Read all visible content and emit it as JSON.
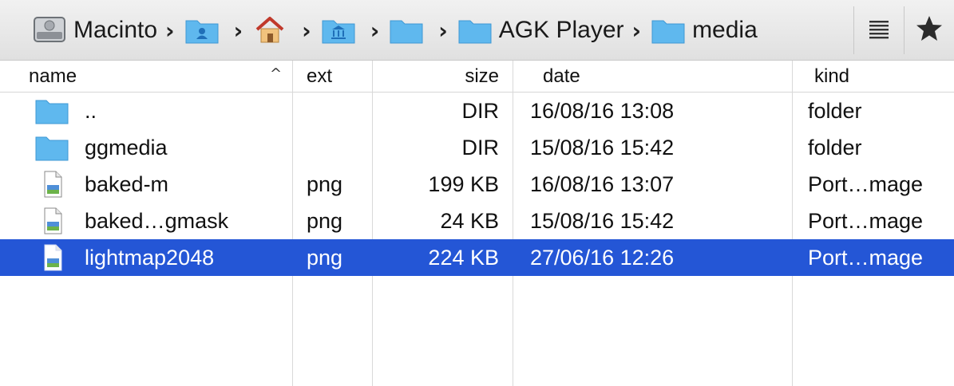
{
  "pathbar": {
    "crumbs": [
      {
        "label": "Macinto",
        "icon": "hard-drive-icon"
      },
      {
        "label": "",
        "icon": "user-home-folder-icon"
      },
      {
        "label": "",
        "icon": "house-icon"
      },
      {
        "label": "",
        "icon": "applications-folder-icon"
      },
      {
        "label": "",
        "icon": "folder-icon"
      },
      {
        "label": "AGK Player",
        "icon": "folder-icon"
      },
      {
        "label": "media",
        "icon": "folder-icon"
      }
    ],
    "separator": "›",
    "view_icon": "list-view-icon",
    "favorite_icon": "star-icon"
  },
  "header": {
    "name": "name",
    "ext": "ext",
    "size": "size",
    "date": "date",
    "kind": "kind",
    "sort_indicator": "^"
  },
  "files": [
    {
      "name": "..",
      "ext": "",
      "size": "DIR",
      "date": "16/08/16 13:08",
      "kind": "folder",
      "icon": "folder-icon",
      "selected": false
    },
    {
      "name": "ggmedia",
      "ext": "",
      "size": "DIR",
      "date": "15/08/16 15:42",
      "kind": "folder",
      "icon": "folder-icon",
      "selected": false
    },
    {
      "name": "baked-m",
      "ext": "png",
      "size": "199 KB",
      "date": "16/08/16 13:07",
      "kind": "Port…mage",
      "icon": "png-file-icon",
      "selected": false
    },
    {
      "name": "baked…gmask",
      "ext": "png",
      "size": "24 KB",
      "date": "15/08/16 15:42",
      "kind": "Port…mage",
      "icon": "png-file-icon",
      "selected": false
    },
    {
      "name": "lightmap2048",
      "ext": "png",
      "size": "224 KB",
      "date": "27/06/16 12:26",
      "kind": "Port…mage",
      "icon": "png-file-icon",
      "selected": true
    }
  ],
  "colors": {
    "selection": "#2456d6",
    "folder": "#5fb8ee"
  }
}
